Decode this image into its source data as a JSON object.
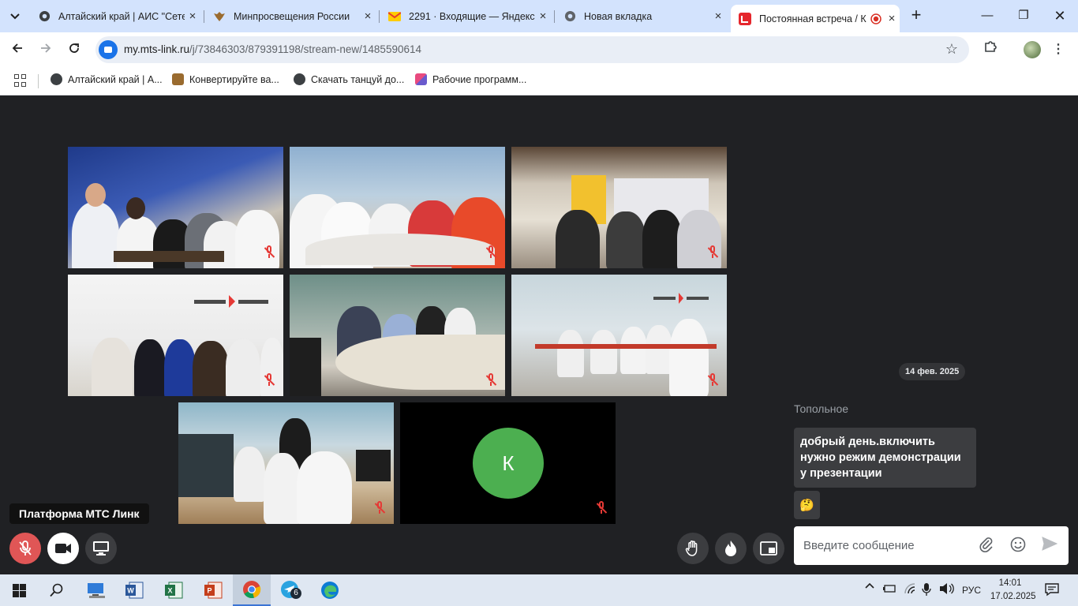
{
  "browser": {
    "tabs": [
      {
        "title": "Алтайский край | АИС \"Сетевой",
        "active": false
      },
      {
        "title": "Минпросвещения России",
        "active": false
      },
      {
        "title": "2291 · Входящие — Яндекс",
        "active": false
      },
      {
        "title": "Новая вкладка",
        "active": false
      },
      {
        "title": "Постоянная встреча / К",
        "active": true
      }
    ],
    "url_host": "my.mts-link.ru",
    "url_path": "/j/73846303/879391198/stream-new/1485590614",
    "bookmarks": [
      {
        "label": "Алтайский край | А..."
      },
      {
        "label": "Конвертируйте ва..."
      },
      {
        "label": "Скачать танцуй до..."
      },
      {
        "label": "Рабочие программ..."
      }
    ]
  },
  "meeting": {
    "avatar_letter": "К",
    "platform_label": "Платформа МТС Линк",
    "chat": {
      "date": "14 фев. 2025",
      "sender": "Топольное",
      "message": "добрый день.включить нужно режим демонстрации у презентации",
      "reaction": "🤔",
      "input_placeholder": "Введите сообщение"
    }
  },
  "taskbar": {
    "telegram_badge": "6",
    "language": "РУС",
    "time": "14:01",
    "date": "17.02.2025"
  },
  "colors": {
    "background": "#202124",
    "mic_off": "#e53935",
    "avatar": "#4caf50",
    "tab_strip": "#d3e3fd"
  }
}
